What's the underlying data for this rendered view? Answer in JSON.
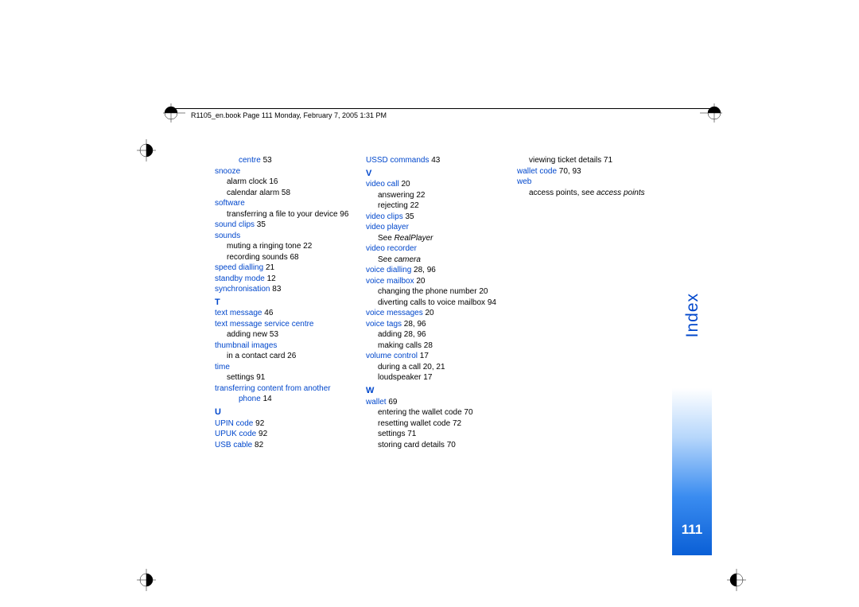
{
  "header": "R1105_en.book  Page 111  Monday, February 7, 2005  1:31 PM",
  "sideTab": "Index",
  "pageNumber": "111",
  "col1": [
    {
      "cls": "entry indent2",
      "parts": [
        {
          "t": "centre",
          "c": "blue"
        },
        {
          "t": " 53",
          "c": "black"
        }
      ]
    },
    {
      "cls": "entry",
      "parts": [
        {
          "t": "snooze",
          "c": "blue"
        }
      ]
    },
    {
      "cls": "entry indent1",
      "parts": [
        {
          "t": "alarm clock 16",
          "c": "black"
        }
      ]
    },
    {
      "cls": "entry indent1",
      "parts": [
        {
          "t": "calendar alarm 58",
          "c": "black"
        }
      ]
    },
    {
      "cls": "entry",
      "parts": [
        {
          "t": "software",
          "c": "blue"
        }
      ]
    },
    {
      "cls": "entry indent1",
      "parts": [
        {
          "t": "transferring a file to your device 96",
          "c": "black"
        }
      ]
    },
    {
      "cls": "entry",
      "parts": [
        {
          "t": "sound clips",
          "c": "blue"
        },
        {
          "t": " 35",
          "c": "black"
        }
      ]
    },
    {
      "cls": "entry",
      "parts": [
        {
          "t": "sounds",
          "c": "blue"
        }
      ]
    },
    {
      "cls": "entry indent1",
      "parts": [
        {
          "t": "muting a ringing tone 22",
          "c": "black"
        }
      ]
    },
    {
      "cls": "entry indent1",
      "parts": [
        {
          "t": "recording sounds 68",
          "c": "black"
        }
      ]
    },
    {
      "cls": "entry",
      "parts": [
        {
          "t": "speed dialling",
          "c": "blue"
        },
        {
          "t": " 21",
          "c": "black"
        }
      ]
    },
    {
      "cls": "entry",
      "parts": [
        {
          "t": "standby mode",
          "c": "blue"
        },
        {
          "t": " 12",
          "c": "black"
        }
      ]
    },
    {
      "cls": "entry",
      "parts": [
        {
          "t": "synchronisation",
          "c": "blue"
        },
        {
          "t": " 83",
          "c": "black"
        }
      ]
    },
    {
      "cls": "letter",
      "parts": [
        {
          "t": "T",
          "c": "blue"
        }
      ]
    },
    {
      "cls": "entry",
      "parts": [
        {
          "t": "text message",
          "c": "blue"
        },
        {
          "t": " 46",
          "c": "black"
        }
      ]
    },
    {
      "cls": "entry",
      "parts": [
        {
          "t": "text message service centre",
          "c": "blue"
        }
      ]
    },
    {
      "cls": "entry indent1",
      "parts": [
        {
          "t": "adding new 53",
          "c": "black"
        }
      ]
    },
    {
      "cls": "entry",
      "parts": [
        {
          "t": "thumbnail images",
          "c": "blue"
        }
      ]
    },
    {
      "cls": "entry indent1",
      "parts": [
        {
          "t": "in a contact card 26",
          "c": "black"
        }
      ]
    },
    {
      "cls": "entry",
      "parts": [
        {
          "t": "time",
          "c": "blue"
        }
      ]
    },
    {
      "cls": "entry indent1",
      "parts": [
        {
          "t": "settings 91",
          "c": "black"
        }
      ]
    },
    {
      "cls": "entry",
      "parts": [
        {
          "t": "transferring content from another",
          "c": "blue"
        }
      ]
    },
    {
      "cls": "entry indent2",
      "parts": [
        {
          "t": "phone",
          "c": "blue"
        },
        {
          "t": " 14",
          "c": "black"
        }
      ]
    },
    {
      "cls": "letter",
      "parts": [
        {
          "t": "U",
          "c": "blue"
        }
      ]
    },
    {
      "cls": "entry",
      "parts": [
        {
          "t": "UPIN code",
          "c": "blue"
        },
        {
          "t": " 92",
          "c": "black"
        }
      ]
    },
    {
      "cls": "entry",
      "parts": [
        {
          "t": "UPUK code",
          "c": "blue"
        },
        {
          "t": " 92",
          "c": "black"
        }
      ]
    },
    {
      "cls": "entry",
      "parts": [
        {
          "t": "USB cable",
          "c": "blue"
        },
        {
          "t": " 82",
          "c": "black"
        }
      ]
    }
  ],
  "col2": [
    {
      "cls": "entry",
      "parts": [
        {
          "t": "USSD commands",
          "c": "blue"
        },
        {
          "t": " 43",
          "c": "black"
        }
      ]
    },
    {
      "cls": "letter",
      "parts": [
        {
          "t": "V",
          "c": "blue"
        }
      ]
    },
    {
      "cls": "entry",
      "parts": [
        {
          "t": "video call",
          "c": "blue"
        },
        {
          "t": " 20",
          "c": "black"
        }
      ]
    },
    {
      "cls": "entry indent1",
      "parts": [
        {
          "t": "answering 22",
          "c": "black"
        }
      ]
    },
    {
      "cls": "entry indent1",
      "parts": [
        {
          "t": "rejecting 22",
          "c": "black"
        }
      ]
    },
    {
      "cls": "entry",
      "parts": [
        {
          "t": "video clips",
          "c": "blue"
        },
        {
          "t": " 35",
          "c": "black"
        }
      ]
    },
    {
      "cls": "entry",
      "parts": [
        {
          "t": "video player",
          "c": "blue"
        }
      ]
    },
    {
      "cls": "entry indent1",
      "parts": [
        {
          "t": "See ",
          "c": "black"
        },
        {
          "t": "RealPlayer",
          "c": "black italic"
        }
      ]
    },
    {
      "cls": "entry",
      "parts": [
        {
          "t": "video recorder",
          "c": "blue"
        }
      ]
    },
    {
      "cls": "entry indent1",
      "parts": [
        {
          "t": "See ",
          "c": "black"
        },
        {
          "t": "camera",
          "c": "black italic"
        }
      ]
    },
    {
      "cls": "entry",
      "parts": [
        {
          "t": "voice dialling",
          "c": "blue"
        },
        {
          "t": " 28, 96",
          "c": "black"
        }
      ]
    },
    {
      "cls": "entry",
      "parts": [
        {
          "t": "voice mailbox",
          "c": "blue"
        },
        {
          "t": " 20",
          "c": "black"
        }
      ]
    },
    {
      "cls": "entry indent1",
      "parts": [
        {
          "t": "changing the phone number 20",
          "c": "black"
        }
      ]
    },
    {
      "cls": "entry indent1",
      "parts": [
        {
          "t": "diverting calls to voice mailbox 94",
          "c": "black"
        }
      ]
    },
    {
      "cls": "entry",
      "parts": [
        {
          "t": "voice messages",
          "c": "blue"
        },
        {
          "t": " 20",
          "c": "black"
        }
      ]
    },
    {
      "cls": "entry",
      "parts": [
        {
          "t": "voice tags",
          "c": "blue"
        },
        {
          "t": " 28, 96",
          "c": "black"
        }
      ]
    },
    {
      "cls": "entry indent1",
      "parts": [
        {
          "t": "adding 28, 96",
          "c": "black"
        }
      ]
    },
    {
      "cls": "entry indent1",
      "parts": [
        {
          "t": "making calls 28",
          "c": "black"
        }
      ]
    },
    {
      "cls": "entry",
      "parts": [
        {
          "t": "volume control",
          "c": "blue"
        },
        {
          "t": " 17",
          "c": "black"
        }
      ]
    },
    {
      "cls": "entry indent1",
      "parts": [
        {
          "t": "during a call 20, 21",
          "c": "black"
        }
      ]
    },
    {
      "cls": "entry indent1",
      "parts": [
        {
          "t": "loudspeaker 17",
          "c": "black"
        }
      ]
    },
    {
      "cls": "letter",
      "parts": [
        {
          "t": "W",
          "c": "blue"
        }
      ]
    },
    {
      "cls": "entry",
      "parts": [
        {
          "t": "wallet",
          "c": "blue"
        },
        {
          "t": " 69",
          "c": "black"
        }
      ]
    },
    {
      "cls": "entry indent1",
      "parts": [
        {
          "t": "entering the wallet code 70",
          "c": "black"
        }
      ]
    },
    {
      "cls": "entry indent1",
      "parts": [
        {
          "t": "resetting wallet code 72",
          "c": "black"
        }
      ]
    },
    {
      "cls": "entry indent1",
      "parts": [
        {
          "t": "settings 71",
          "c": "black"
        }
      ]
    },
    {
      "cls": "entry indent1",
      "parts": [
        {
          "t": "storing card details 70",
          "c": "black"
        }
      ]
    }
  ],
  "col3": [
    {
      "cls": "entry indent1",
      "parts": [
        {
          "t": "viewing ticket details 71",
          "c": "black"
        }
      ]
    },
    {
      "cls": "entry",
      "parts": [
        {
          "t": "wallet code",
          "c": "blue"
        },
        {
          "t": " 70, 93",
          "c": "black"
        }
      ]
    },
    {
      "cls": "entry",
      "parts": [
        {
          "t": "web",
          "c": "blue"
        }
      ]
    },
    {
      "cls": "entry indent1",
      "parts": [
        {
          "t": "access points, see ",
          "c": "black"
        },
        {
          "t": "access points",
          "c": "black italic"
        }
      ]
    }
  ]
}
